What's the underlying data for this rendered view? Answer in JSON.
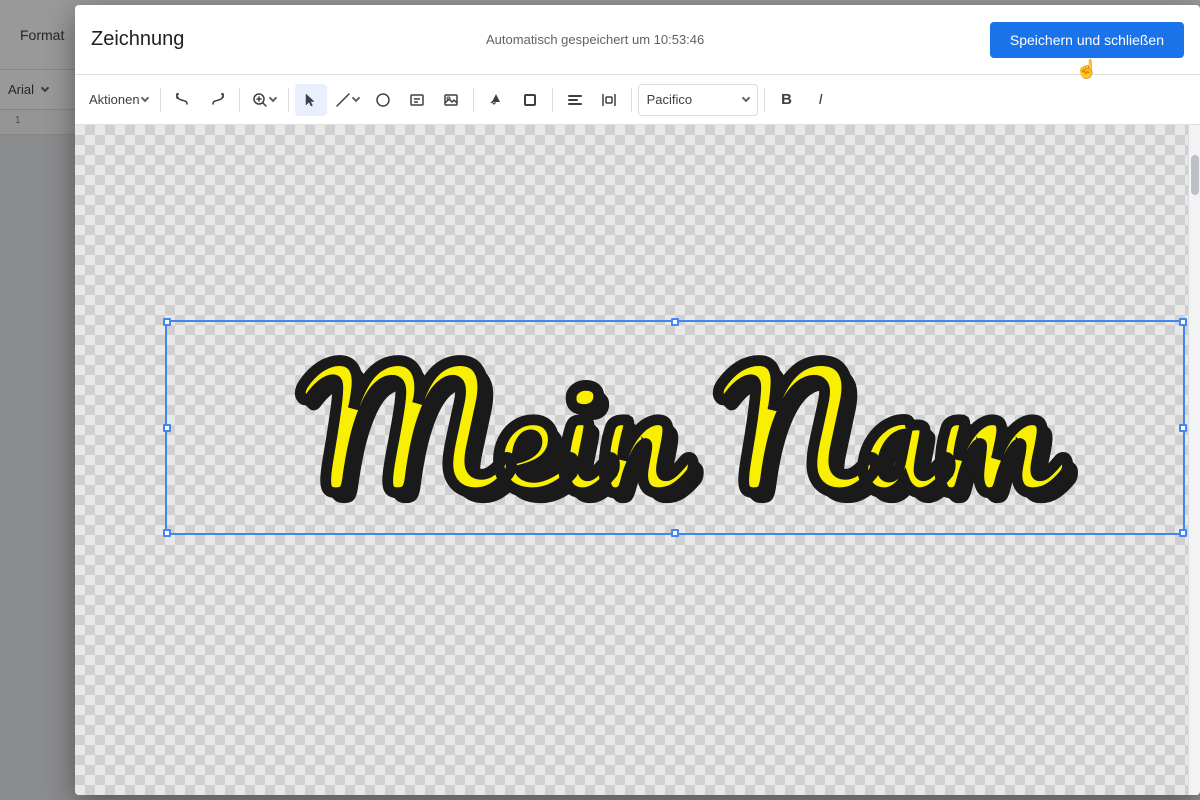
{
  "app": {
    "format_label": "Format",
    "font_name": "Arial",
    "ruler_page": "1"
  },
  "dialog": {
    "title": "Zeichnung",
    "autosave_text": "Automatisch gespeichert um 10:53:46",
    "save_close_label": "Speichern und schließen",
    "toolbar": {
      "aktionen_label": "Aktionen",
      "font_name": "Pacifico",
      "bold_label": "B",
      "italic_label": "I"
    },
    "canvas": {
      "text_content": "Mein Nam"
    }
  }
}
